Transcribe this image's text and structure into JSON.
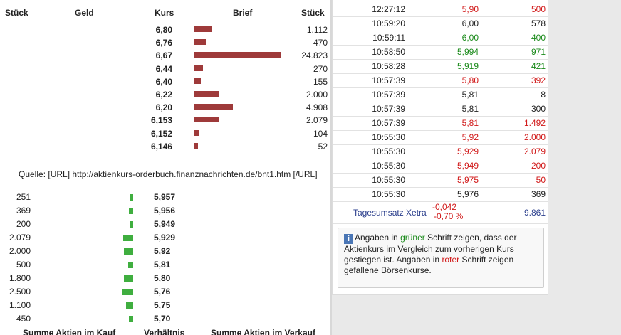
{
  "orderbook": {
    "headers": {
      "qty_bid": "Stück",
      "bid": "Geld",
      "price": "Kurs",
      "ask": "Brief",
      "qty_ask": "Stück"
    },
    "asks": [
      {
        "price": "6,80",
        "qty": "1.112",
        "size": 1112
      },
      {
        "price": "6,76",
        "qty": "470",
        "size": 470
      },
      {
        "price": "6,67",
        "qty": "24.823",
        "size": 24823
      },
      {
        "price": "6,44",
        "qty": "270",
        "size": 270
      },
      {
        "price": "6,40",
        "qty": "155",
        "size": 155
      },
      {
        "price": "6,22",
        "qty": "2.000",
        "size": 2000
      },
      {
        "price": "6,20",
        "qty": "4.908",
        "size": 4908
      },
      {
        "price": "6,153",
        "qty": "2.079",
        "size": 2079
      },
      {
        "price": "6,152",
        "qty": "104",
        "size": 104
      },
      {
        "price": "6,146",
        "qty": "52",
        "size": 52
      }
    ],
    "source": "Quelle: [URL] http://aktienkurs-orderbuch.finanznachrichten.de/bnt1.htm [/URL]",
    "bids": [
      {
        "qty": "251",
        "price": "5,957",
        "size": 251
      },
      {
        "qty": "369",
        "price": "5,956",
        "size": 369
      },
      {
        "qty": "200",
        "price": "5,949",
        "size": 200
      },
      {
        "qty": "2.079",
        "price": "5,929",
        "size": 2079
      },
      {
        "qty": "2.000",
        "price": "5,92",
        "size": 2000
      },
      {
        "qty": "500",
        "price": "5,81",
        "size": 500
      },
      {
        "qty": "1.800",
        "price": "5,80",
        "size": 1800
      },
      {
        "qty": "2.500",
        "price": "5,76",
        "size": 2500
      },
      {
        "qty": "1.100",
        "price": "5,75",
        "size": 1100
      },
      {
        "qty": "450",
        "price": "5,70",
        "size": 450
      }
    ],
    "footer": {
      "sum_buy": "Summe Aktien im Kauf",
      "ratio": "Verhältnis",
      "sum_sell": "Summe Aktien im Verkauf"
    }
  },
  "trades": [
    {
      "time": "12:27:12",
      "price": "5,90",
      "qty": "500",
      "dir": "down"
    },
    {
      "time": "10:59:20",
      "price": "6,00",
      "qty": "578",
      "dir": "flat"
    },
    {
      "time": "10:59:11",
      "price": "6,00",
      "qty": "400",
      "dir": "up"
    },
    {
      "time": "10:58:50",
      "price": "5,994",
      "qty": "971",
      "dir": "up"
    },
    {
      "time": "10:58:28",
      "price": "5,919",
      "qty": "421",
      "dir": "up"
    },
    {
      "time": "10:57:39",
      "price": "5,80",
      "qty": "392",
      "dir": "down"
    },
    {
      "time": "10:57:39",
      "price": "5,81",
      "qty": "8",
      "dir": "flat"
    },
    {
      "time": "10:57:39",
      "price": "5,81",
      "qty": "300",
      "dir": "flat"
    },
    {
      "time": "10:57:39",
      "price": "5,81",
      "qty": "1.492",
      "dir": "down"
    },
    {
      "time": "10:55:30",
      "price": "5,92",
      "qty": "2.000",
      "dir": "down"
    },
    {
      "time": "10:55:30",
      "price": "5,929",
      "qty": "2.079",
      "dir": "down"
    },
    {
      "time": "10:55:30",
      "price": "5,949",
      "qty": "200",
      "dir": "down"
    },
    {
      "time": "10:55:30",
      "price": "5,975",
      "qty": "50",
      "dir": "down"
    },
    {
      "time": "10:55:30",
      "price": "5,976",
      "qty": "369",
      "dir": "flat"
    }
  ],
  "turnover": {
    "label": "Tagesumsatz Xetra",
    "change_abs": "-0,042",
    "change_pct": "-0,70 %",
    "volume": "9.861"
  },
  "info": {
    "icon": "info-icon",
    "text_1": "Angaben in ",
    "green_word": "grüner",
    "text_2": " Schrift zeigen, dass der Aktienkurs im Vergleich zum vorherigen Kurs gestiegen ist. Angaben in ",
    "red_word": "roter",
    "text_3": " Schrift zeigen gefallene Börsenkurse."
  },
  "colors": {
    "ask_bar": "#9e3a3a",
    "bid_bar": "#3fae3f",
    "up": "#1a8a1a",
    "down": "#d11818",
    "label_blue": "#2a3e8c"
  }
}
